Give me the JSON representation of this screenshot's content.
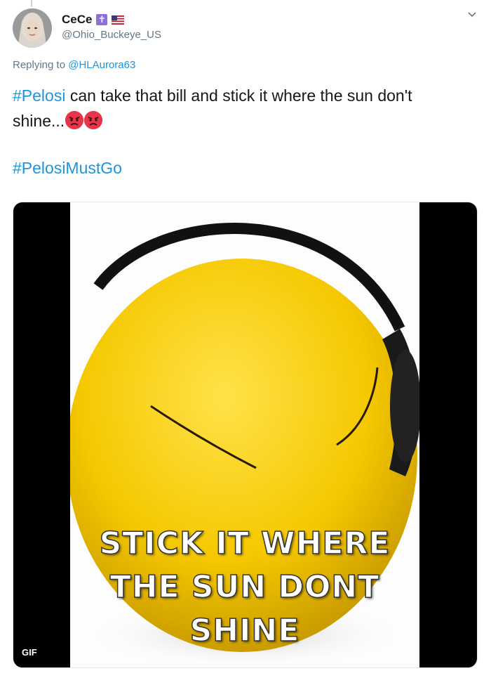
{
  "tweet": {
    "display_name": "CeCe",
    "handle": "@Ohio_Buckeye_US",
    "reply_prefix": "Replying to",
    "reply_to": "@HLAurora63",
    "hashtag1": "#Pelosi",
    "body": " can take that bill and stick it where the sun don't shine...",
    "hashtag2": "#PelosiMustGo",
    "emoji": "angry-face-icon"
  },
  "media": {
    "caption_line1": "STICK IT WHERE",
    "caption_line2": "THE SUN DONT",
    "caption_line3": "SHINE",
    "type_badge": "GIF"
  },
  "colors": {
    "link": "#1b95e0",
    "secondary_text": "#657786",
    "primary_text": "#14171a"
  }
}
